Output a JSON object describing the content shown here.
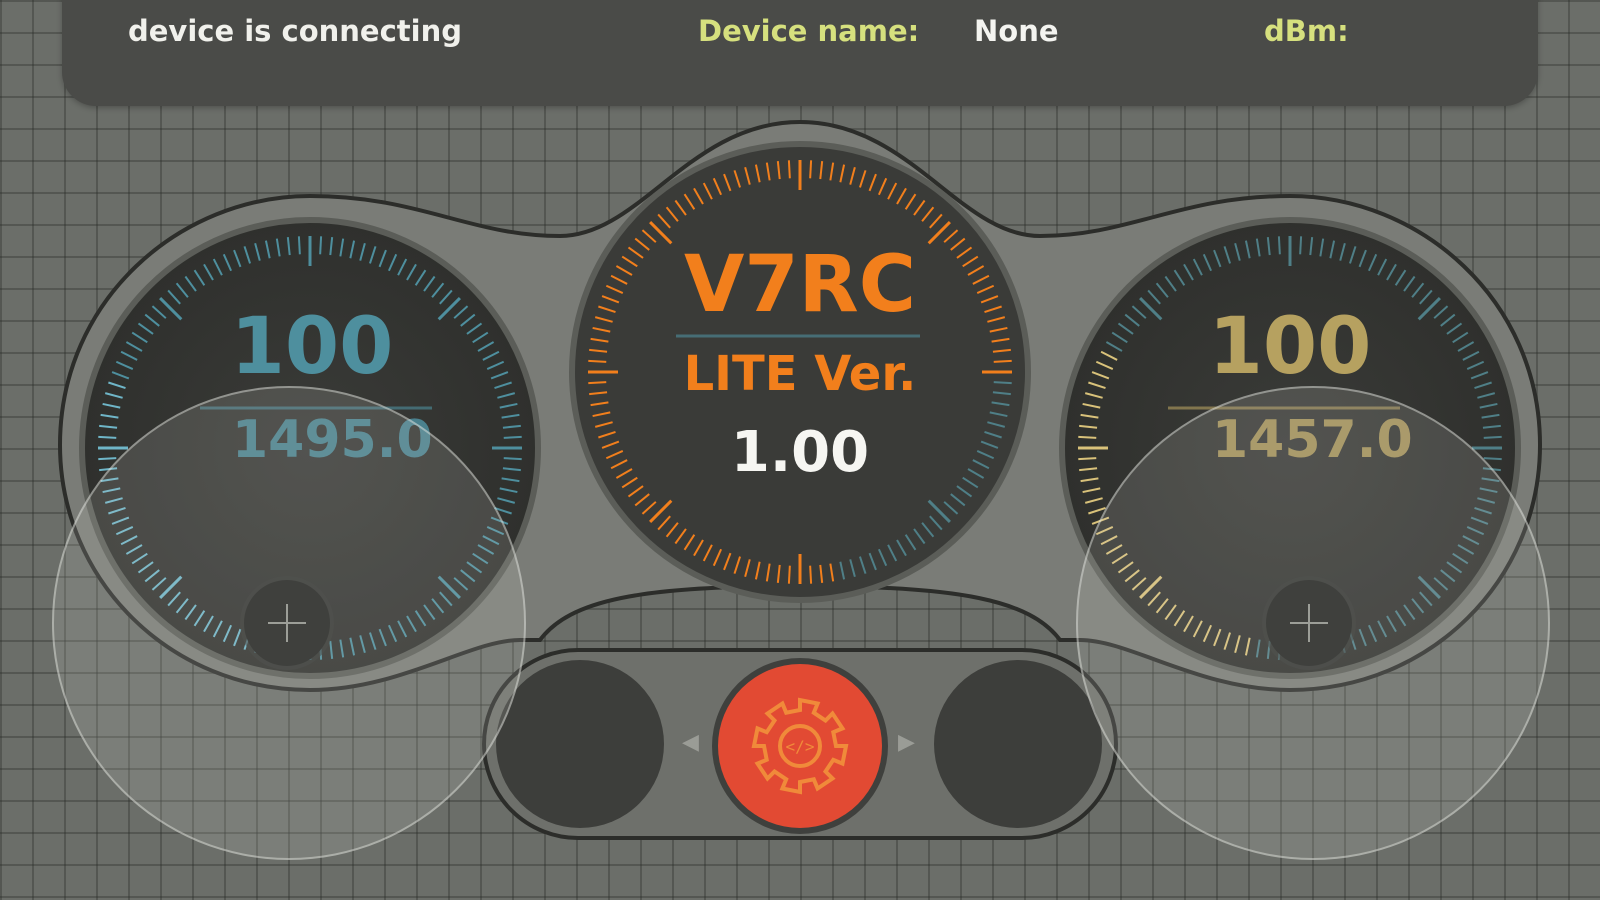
{
  "status_bar": {
    "status_text": "device is connecting",
    "device_name_label": "Device name:",
    "device_name_value": "None",
    "dbm_label": "dBm:"
  },
  "left_gauge": {
    "percent": "100",
    "value": "1495.0",
    "color": "#4e8f9e"
  },
  "center_gauge": {
    "title": "V7RC",
    "subtitle": "LITE Ver.",
    "version": "1.00",
    "color": "#f27f1c"
  },
  "right_gauge": {
    "percent": "100",
    "value": "1457.0",
    "color": "#b6a160"
  },
  "controls": {
    "settings_icon": "gear-code-icon",
    "settings_color": "#e24a33",
    "prev_icon": "chevron-left-icon",
    "next_icon": "chevron-right-icon"
  }
}
